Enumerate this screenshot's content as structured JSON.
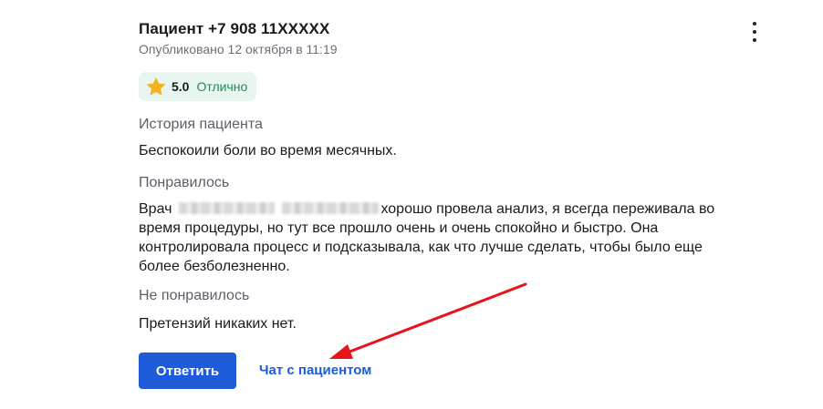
{
  "review": {
    "author": "Пациент +7 908 11XXXXX",
    "published": "Опубликовано 12 октября в 11:19",
    "menu_icon": "more-vertical-icon",
    "rating": {
      "icon": "star-icon",
      "value": "5.0",
      "label": "Отлично",
      "star_color": "#f5b324",
      "bg_color": "#e7f6ee",
      "label_color": "#1f8a55"
    },
    "history": {
      "title": "История пациента",
      "text": "Беспокоили боли во время месячных."
    },
    "liked": {
      "title": "Понравилось",
      "prefix": "Врач",
      "text": "хорошо провела анализ, я всегда переживала во время процедуры, но тут все прошло очень и очень спокойно и быстро. Она контролировала процесс и подсказывала, как что лучше сделать, чтобы было еще более безболезненно."
    },
    "disliked": {
      "title": "Не понравилось",
      "text": "Претензий никаких нет."
    }
  },
  "actions": {
    "reply_label": "Ответить",
    "chat_label": "Чат с пациентом",
    "primary_color": "#1d5bd8"
  },
  "annotation": {
    "arrow_color": "#e8141c"
  }
}
